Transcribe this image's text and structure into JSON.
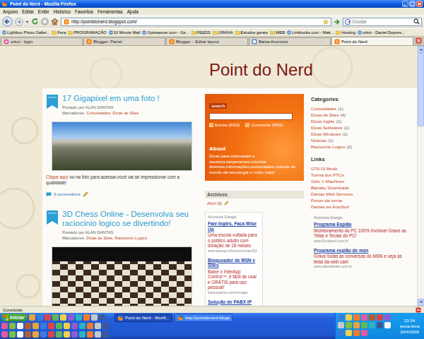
{
  "window": {
    "title": "Point do Nerd - Mozilla Firefox"
  },
  "menu": [
    "Arquivo",
    "Editar",
    "Exibir",
    "Histórico",
    "Favoritos",
    "Ferramentas",
    "Ajuda"
  ],
  "toolbar": {
    "url": "http://pointdonerd.blogspot.com/",
    "search_placeholder": "Google"
  },
  "bookmarks": [
    {
      "label": "Lightbox Photo Galler...",
      "kind": "link"
    },
    {
      "label": "Fera",
      "kind": "folder"
    },
    {
      "label": "PROGRAMAÇÃO",
      "kind": "folder"
    },
    {
      "label": "10 Minute Mail",
      "kind": "link"
    },
    {
      "label": "Gptreasure.com - Ge...",
      "kind": "link"
    },
    {
      "label": "FEEDS",
      "kind": "folder"
    },
    {
      "label": "GRANA",
      "kind": "folder"
    },
    {
      "label": "Estudos gerais",
      "kind": "folder"
    },
    {
      "label": "WEB",
      "kind": "folder"
    },
    {
      "label": "Linkbucks.com - Mak...",
      "kind": "link"
    },
    {
      "label": "Hosting",
      "kind": "folder"
    },
    {
      "label": "orkut - Daniel Depres...",
      "kind": "link"
    }
  ],
  "tabs": [
    {
      "label": "orkut - login",
      "selected": false
    },
    {
      "label": "Blogger: Painel",
      "selected": false
    },
    {
      "label": "Blogger :: Editar layout",
      "selected": false
    },
    {
      "label": "Baixa-Anuncios",
      "selected": false
    },
    {
      "label": "Point do Nerd",
      "selected": true
    }
  ],
  "blog": {
    "title": "Point do Nerd",
    "posts": [
      {
        "title": "17 Gigapixel em uma foto !",
        "byline": "Postado por ALAN DANTAS",
        "labels_heading": "Marcadores:",
        "labels": "Curiosidades, Dicas de Sites",
        "body_link": "Clique aqui",
        "body": " ou na foto para acessar,você vai se impressionar com a qualidade!",
        "comments": "0 comentários"
      },
      {
        "title": "3D Chess Online - Desenvolva seu raciocinio logico se divertindo!",
        "byline": "Postado por ALAN DANTAS",
        "labels_heading": "Marcadores:",
        "labels": "Dicas de Sites, Raciocinio Logico"
      }
    ],
    "search_box": {
      "title": "search",
      "feeds": [
        "Entries (RSS)",
        "Comments (RSS)"
      ],
      "about_title": "About",
      "about_text": "Dicas para webmaster e usuarios,lançamentos,tutoriais diversos,informações,curiosidades,noticias do mundo da tecnologia e muito mais!"
    },
    "archives": {
      "title": "Archives",
      "items": [
        "Abril (9)"
      ]
    },
    "ads_middle": {
      "heading": "Anúncios Google",
      "ads": [
        {
          "title": "Fale Inglês, Faça Wise Up",
          "text": "Uma escola voltada para o público adulto com duração de 18 meses.",
          "url": "www.wiseup.tv/home/minhas/f02"
        },
        {
          "title": "Bloqueador de MSN e Sites",
          "text": "Baixe o InterApp Control™, é fácil de usar e GRÁTIS para uso pessoal!",
          "url": "www.quartzo.com/interapp"
        },
        {
          "title": "Solução de PABX IP"
        }
      ]
    },
    "categories": {
      "title": "Categories",
      "items": [
        {
          "name": "Curiosidades",
          "count": "(1)"
        },
        {
          "name": "Dicas de Sites",
          "count": "(4)"
        },
        {
          "name": "Dicas Inglês",
          "count": "(1)"
        },
        {
          "name": "Dicas Softwares",
          "count": "(1)"
        },
        {
          "name": "Dicas Windows",
          "count": "(1)"
        },
        {
          "name": "Noticias",
          "count": "(1)"
        },
        {
          "name": "Raciocinio Logico",
          "count": "(2)"
        }
      ]
    },
    "links": {
      "title": "Links",
      "items": [
        "GTA Gt Mode",
        "Turma dos PTCs",
        "Girls 'n Machines",
        "Baixaky Downloads",
        "Dantas Web Services",
        "Forum da turma",
        "Dantas ws AutoSurf"
      ]
    },
    "ads_right": {
      "heading": "Anúncios Google",
      "ads": [
        {
          "title": "Programa Espião",
          "text": "Monitoramento do PC 100% Invisível Grave as Telas e Teclas do PC!",
          "url": "www.Syndasoft.com.br"
        },
        {
          "title": "Programa espião de msn",
          "text": "Grave todas as conversas do MSN e veja as telas da web cam",
          "url": "www.vikesoftware.com.br"
        }
      ]
    }
  },
  "scrollbar": {
    "level": 0.3
  },
  "status_bar": "Concluído",
  "taskbar": {
    "start": "Iniciar",
    "tasks": [
      {
        "label": "Point do Nerd - Mozill...",
        "selected": true
      },
      {
        "label": "http://pointdonerd.blogs...",
        "selected": false
      }
    ],
    "clock": {
      "time": "23:34",
      "day": "sexta-feira",
      "date": "24/4/2009"
    }
  }
}
